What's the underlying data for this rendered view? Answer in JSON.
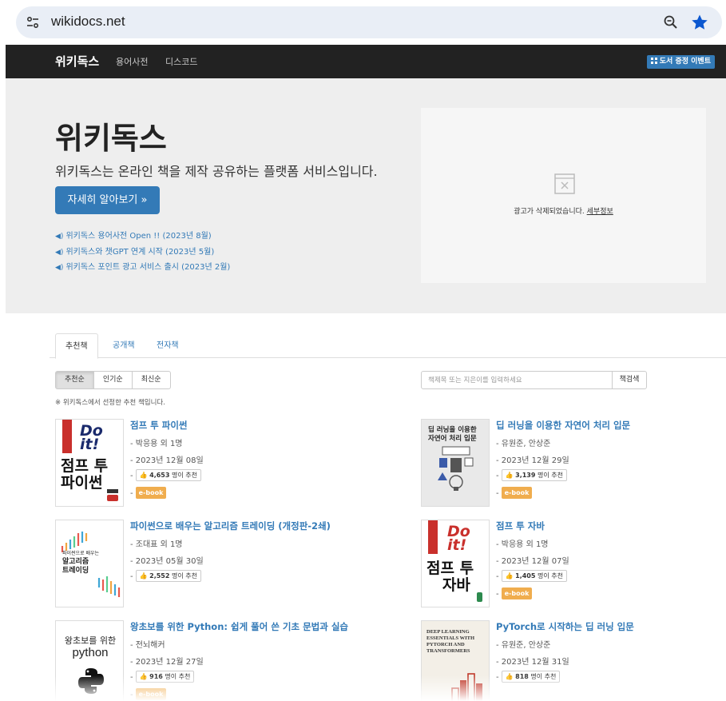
{
  "browser": {
    "url": "wikidocs.net"
  },
  "navbar": {
    "brand": "위키독스",
    "links": [
      "용어사전",
      "디스코드"
    ],
    "event_button": "도서 증정 이벤트"
  },
  "hero": {
    "title": "위키독스",
    "subtitle": "위키독스는 온라인 책을 제작 공유하는 플랫폼 서비스입니다.",
    "button": "자세히 알아보기 »",
    "news": [
      "위키독스 용어사전 Open !! (2023년 8월)",
      "위키독스와 챗GPT 연계 시작 (2023년 5월)",
      "위키독스 포인트 광고 서비스 출시 (2023년 2월)"
    ],
    "ad": {
      "text": "광고가 삭제되었습니다.",
      "link": "세부정보"
    }
  },
  "tabs": [
    "추천책",
    "공개책",
    "전자책"
  ],
  "sort": [
    "추천순",
    "인기순",
    "최신순"
  ],
  "note": "※ 위키독스에서 선정한 추천 책입니다.",
  "search": {
    "placeholder": "책제목 또는 지은이를 입력하세요",
    "button": "책검색"
  },
  "common": {
    "dash": "-",
    "rec_suffix": "명이 추천",
    "ebook": "e-book"
  },
  "books": [
    {
      "title": "점프 투 파이썬",
      "author": "- 박응용 외 1명",
      "date": "- 2023년 12월 08일",
      "recommend": "4,653",
      "cover": {
        "a": "Do it!",
        "b": "점프 투",
        "c": "파이썬"
      }
    },
    {
      "title": "딥 러닝을 이용한 자연어 처리 입문",
      "author": "- 유원준, 안상준",
      "date": "- 2023년 12월 29일",
      "recommend": "3,139",
      "cover": {
        "a": "딥 러닝을 이용한",
        "b": "자연어 처리 입문"
      }
    },
    {
      "title": "파이썬으로 배우는 알고리즘 트레이딩 (개정판-2쇄)",
      "author": "- 조대표 외 1명",
      "date": "- 2023년 05월 30일",
      "recommend": "2,552",
      "cover": {
        "a": "파이썬으로 배우는",
        "b": "알고리즘",
        "c": "트레이딩"
      }
    },
    {
      "title": "점프 투 자바",
      "author": "- 박응용 외 1명",
      "date": "- 2023년 12월 07일",
      "recommend": "1,405",
      "cover": {
        "a": "Do it!",
        "b": "점프 투",
        "c": "자바"
      }
    },
    {
      "title": "왕초보를 위한 Python: 쉽게 풀어 쓴 기초 문법과 실습",
      "author": "- 전뇌해커",
      "date": "- 2023년 12월 27일",
      "recommend": "916",
      "cover": {
        "a": "왕초보를 위한",
        "b": "python"
      }
    },
    {
      "title": "PyTorch로 시작하는 딥 러닝 입문",
      "author": "- 유원준, 안상준",
      "date": "- 2023년 12월 31일",
      "recommend": "818",
      "cover": {
        "a": "DEEP LEARNING",
        "b": "ESSENTIALS WITH",
        "c": "PYTORCH AND",
        "d": "TRANSFORMERS"
      }
    }
  ],
  "colors": {
    "navbar": "#222222",
    "primary": "#337ab7",
    "ebook": "#f0ad4e",
    "hero_bg": "#eeeeee"
  }
}
